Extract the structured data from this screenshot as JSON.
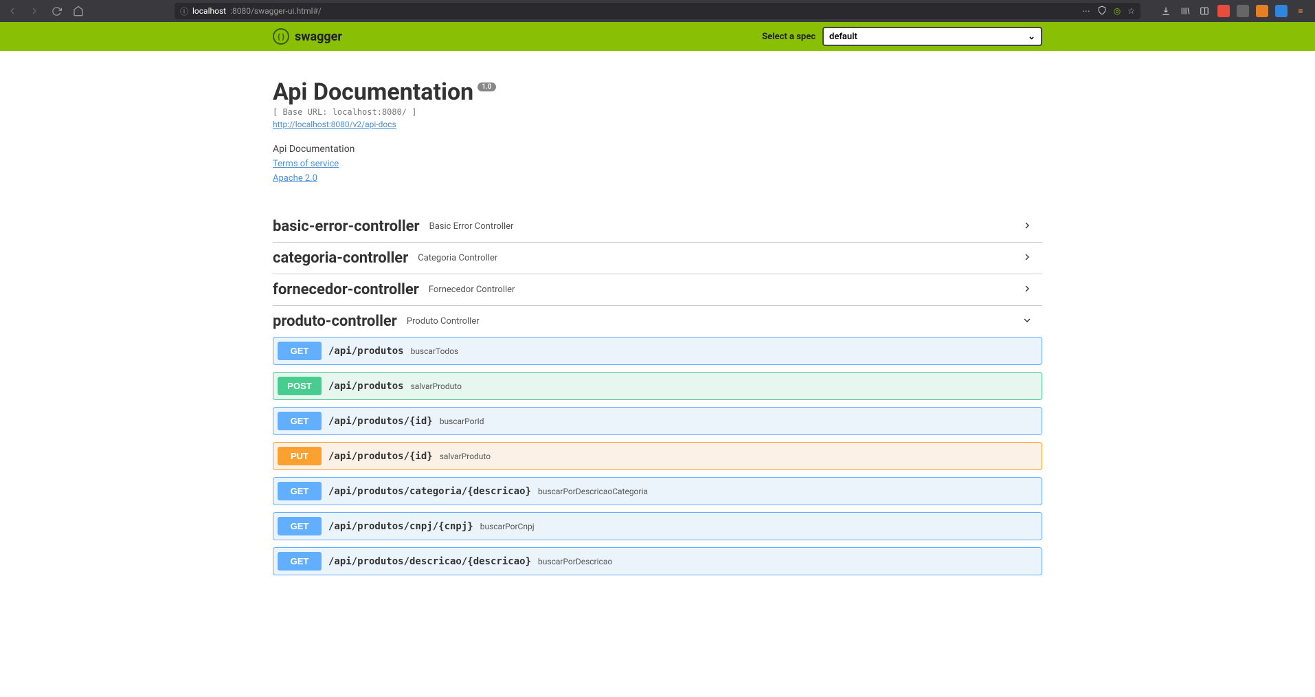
{
  "browser": {
    "url_host": "localhost",
    "url_rest": ":8080/swagger-ui.html#/"
  },
  "header": {
    "brand": "swagger",
    "spec_label": "Select a spec",
    "spec_selected": "default"
  },
  "info": {
    "title": "Api Documentation",
    "version": "1.0",
    "base_url": "[ Base URL: localhost:8080/ ]",
    "docs_url": "http://localhost:8080/v2/api-docs",
    "description": "Api Documentation",
    "tos": "Terms of service",
    "license": "Apache 2.0"
  },
  "tags": [
    {
      "name": "basic-error-controller",
      "desc": "Basic Error Controller",
      "expanded": false
    },
    {
      "name": "categoria-controller",
      "desc": "Categoria Controller",
      "expanded": false
    },
    {
      "name": "fornecedor-controller",
      "desc": "Fornecedor Controller",
      "expanded": false
    },
    {
      "name": "produto-controller",
      "desc": "Produto Controller",
      "expanded": true
    }
  ],
  "ops": [
    {
      "method": "GET",
      "cls": "get",
      "path": "/api/produtos",
      "summary": "buscarTodos"
    },
    {
      "method": "POST",
      "cls": "post",
      "path": "/api/produtos",
      "summary": "salvarProduto"
    },
    {
      "method": "GET",
      "cls": "get",
      "path": "/api/produtos/{id}",
      "summary": "buscarPorId"
    },
    {
      "method": "PUT",
      "cls": "put",
      "path": "/api/produtos/{id}",
      "summary": "salvarProduto"
    },
    {
      "method": "GET",
      "cls": "get",
      "path": "/api/produtos/categoria/{descricao}",
      "summary": "buscarPorDescricaoCategoria"
    },
    {
      "method": "GET",
      "cls": "get",
      "path": "/api/produtos/cnpj/{cnpj}",
      "summary": "buscarPorCnpj"
    },
    {
      "method": "GET",
      "cls": "get",
      "path": "/api/produtos/descricao/{descricao}",
      "summary": "buscarPorDescricao"
    }
  ]
}
